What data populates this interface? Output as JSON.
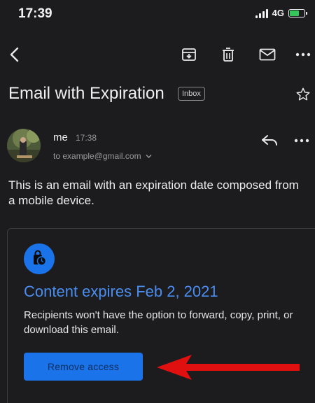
{
  "status": {
    "time": "17:39",
    "network": "4G"
  },
  "email": {
    "subject": "Email with Expiration",
    "label_chip": "Inbox",
    "sender": "me",
    "sent_time": "17:38",
    "recipient": "to example@gmail.com",
    "body": "This is an email with an expiration date composed from a mobile device."
  },
  "confidential": {
    "title": "Content expires Feb 2, 2021",
    "description": "Recipients won't have the option to forward, copy, print, or download this email.",
    "button_label": "Remove access"
  },
  "colors": {
    "background": "#1c1c1e",
    "accent": "#1a73e8",
    "accent_text": "#4a8df0",
    "annotation_arrow": "#e01010",
    "battery": "#34c759"
  },
  "icons": [
    "back-arrow-icon",
    "archive-icon",
    "trash-icon",
    "mail-icon",
    "more-vert-icon",
    "star-icon",
    "reply-icon",
    "clock-lock-icon",
    "chevron-down-icon"
  ]
}
